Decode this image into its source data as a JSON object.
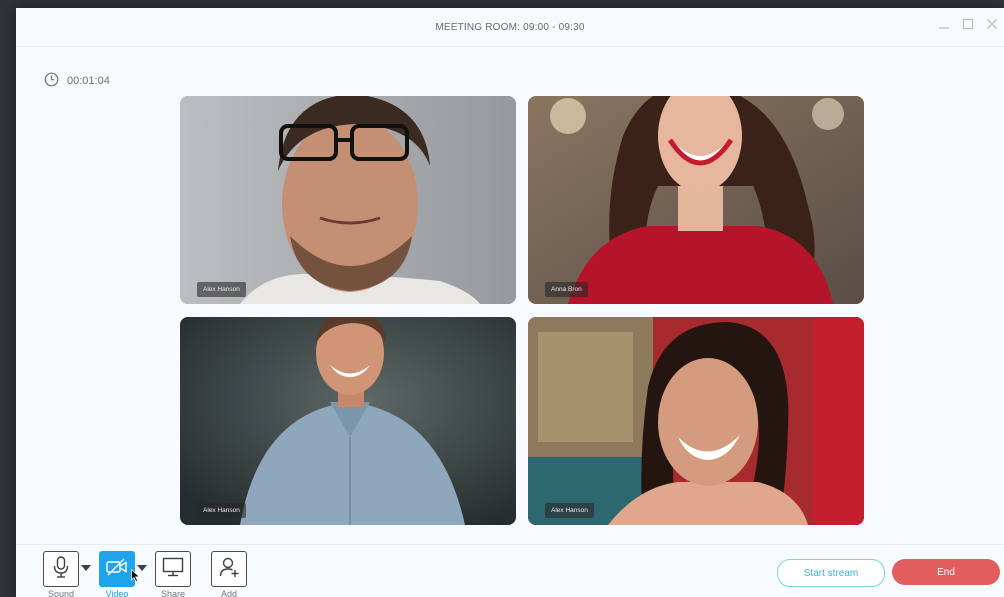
{
  "window": {
    "title": "MEETING ROOM: 09:00 - 09:30"
  },
  "timer": {
    "elapsed": "00:01:04"
  },
  "participants": [
    {
      "name": "Alex Hanson",
      "bg": "#aeb1b4"
    },
    {
      "name": "Anna Bron",
      "bg": "#7f6a55"
    },
    {
      "name": "Alex Hanson",
      "bg": "#46504f"
    },
    {
      "name": "Alex Hanson",
      "bg": "#b4232c"
    }
  ],
  "controls": {
    "sound_label": "Sound",
    "video_label": "Video",
    "share_label": "Share",
    "add_label": "Add",
    "start_stream_label": "Start stream",
    "end_label": "End"
  },
  "colors": {
    "accent": "#1fa3e9",
    "end": "#e25d5d",
    "stream_border": "#7fd0e0"
  }
}
